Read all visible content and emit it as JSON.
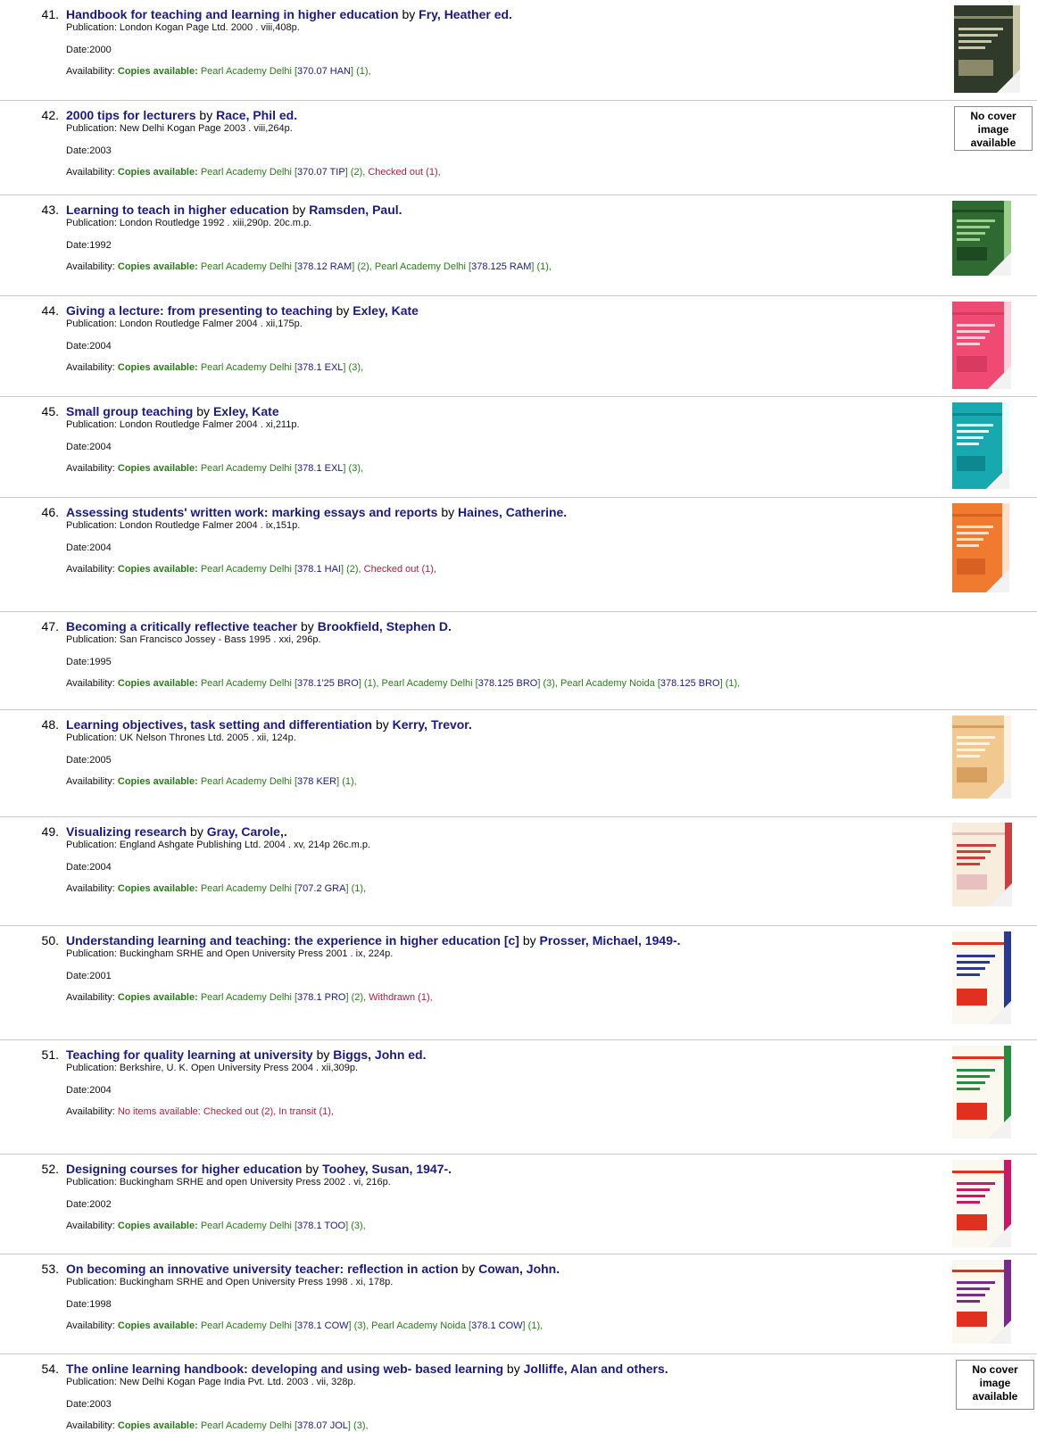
{
  "records": [
    {
      "num": "41.",
      "title": "Handbook for teaching and learning in higher education",
      "by": "by",
      "author": "Fry, Heather ed.",
      "publication": "Publication: London Kogan Page Ltd. 2000 . viii,408p.",
      "date": "Date:2000",
      "availability_label": "Availability:",
      "availability": [
        {
          "kind": "ca",
          "text": "Copies available:"
        },
        {
          "kind": "lib",
          "text": " Pearl Academy Delhi ["
        },
        {
          "kind": "call",
          "text": "370.07 HAN"
        },
        {
          "kind": "lib",
          "text": "] (1),"
        }
      ],
      "cover": {
        "type": "image",
        "bg": "#2f3a2a",
        "accent": "#c8c8a8",
        "band": "#8a8a6a",
        "text": "TEACHING & LEARNING IN HIGHER EDUCATION"
      }
    },
    {
      "num": "42.",
      "title": "2000 tips for lecturers",
      "by": "by",
      "author": "Race, Phil ed.",
      "publication": "Publication: New Delhi Kogan Page 2003 . viii,264p.",
      "date": "Date:2003",
      "availability_label": "Availability:",
      "availability": [
        {
          "kind": "ca",
          "text": "Copies available:"
        },
        {
          "kind": "lib",
          "text": " Pearl Academy Delhi ["
        },
        {
          "kind": "call",
          "text": "370.07 TIP"
        },
        {
          "kind": "lib",
          "text": "] (2),"
        },
        {
          "kind": "co",
          "text": " Checked out (1),"
        }
      ],
      "cover": {
        "type": "none",
        "text": "No cover image available"
      }
    },
    {
      "num": "43.",
      "title": "Learning to teach in higher education",
      "by": "by",
      "author": "Ramsden, Paul.",
      "publication": "Publication: London Routledge 1992 . xiii,290p. 20c.m.p.",
      "date": "Date:1992",
      "availability_label": "Availability:",
      "availability": [
        {
          "kind": "ca",
          "text": "Copies available:"
        },
        {
          "kind": "lib",
          "text": " Pearl Academy Delhi ["
        },
        {
          "kind": "call",
          "text": "378.12 RAM"
        },
        {
          "kind": "lib",
          "text": "] (2), Pearl Academy Delhi ["
        },
        {
          "kind": "call",
          "text": "378.125 RAM"
        },
        {
          "kind": "lib",
          "text": "] (1),"
        }
      ],
      "cover": {
        "type": "image",
        "bg": "#2e6a32",
        "accent": "#9ad08a",
        "band": "#1e4a22",
        "text": "Learning TO TEACH IN HIGHER EDUCATION"
      }
    },
    {
      "num": "44.",
      "title": "Giving a lecture: from presenting to teaching",
      "by": "by",
      "author": "Exley, Kate",
      "publication": "Publication: London Routledge Falmer 2004 . xii,175p.",
      "date": "Date:2004",
      "availability_label": "Availability:",
      "availability": [
        {
          "kind": "ca",
          "text": "Copies available:"
        },
        {
          "kind": "lib",
          "text": " Pearl Academy Delhi ["
        },
        {
          "kind": "call",
          "text": "378.1 EXL"
        },
        {
          "kind": "lib",
          "text": "] (3),"
        }
      ],
      "cover": {
        "type": "image",
        "bg": "#f04a72",
        "accent": "#ffd0dc",
        "band": "#d83a60",
        "text": "GIVING A LECTURE"
      }
    },
    {
      "num": "45.",
      "title": "Small group teaching",
      "by": "by",
      "author": "Exley, Kate",
      "publication": "Publication: London Routledge Falmer 2004 . xi,211p.",
      "date": "Date:2004",
      "availability_label": "Availability:",
      "availability": [
        {
          "kind": "ca",
          "text": "Copies available:"
        },
        {
          "kind": "lib",
          "text": " Pearl Academy Delhi ["
        },
        {
          "kind": "call",
          "text": "378.1 EXL"
        },
        {
          "kind": "lib",
          "text": "] (3),"
        }
      ],
      "cover": {
        "type": "image",
        "bg": "#18a8b0",
        "accent": "#e8ffff",
        "band": "#0e8890",
        "text": "SMALL GROUP TEACHING"
      }
    },
    {
      "num": "46.",
      "title": "Assessing students' written work: marking essays and reports",
      "by": "by",
      "author": "Haines, Catherine.",
      "publication": "Publication: London Routledge Falmer 2004 . ix,151p.",
      "date": "Date:2004",
      "availability_label": "Availability:",
      "availability": [
        {
          "kind": "ca",
          "text": "Copies available:"
        },
        {
          "kind": "lib",
          "text": " Pearl Academy Delhi ["
        },
        {
          "kind": "call",
          "text": "378.1 HAI"
        },
        {
          "kind": "lib",
          "text": "] (2),"
        },
        {
          "kind": "co",
          "text": " Checked out (1),"
        }
      ],
      "cover": {
        "type": "image",
        "bg": "#f07a30",
        "accent": "#ffe0c8",
        "band": "#d86020",
        "text": "ASSESSING STUDENTS' WRITTEN WORK"
      }
    },
    {
      "num": "47.",
      "title": "Becoming a critically reflective teacher",
      "by": "by",
      "author": "Brookfield, Stephen D.",
      "publication": "Publication: San Francisco Jossey - Bass 1995 . xxi, 296p.",
      "date": "Date:1995",
      "availability_label": "Availability:",
      "availability": [
        {
          "kind": "ca",
          "text": "Copies available:"
        },
        {
          "kind": "lib",
          "text": " Pearl Academy Delhi ["
        },
        {
          "kind": "call",
          "text": "378.1'25 BRO"
        },
        {
          "kind": "lib",
          "text": "] (1), Pearl Academy Delhi ["
        },
        {
          "kind": "call",
          "text": "378.125 BRO"
        },
        {
          "kind": "lib",
          "text": "] (3), Pearl Academy Noida ["
        },
        {
          "kind": "call",
          "text": "378.125 BRO"
        },
        {
          "kind": "lib",
          "text": "] (1),"
        }
      ],
      "cover": {
        "type": "blank"
      }
    },
    {
      "num": "48.",
      "title": "Learning objectives, task setting and differentiation",
      "by": "by",
      "author": "Kerry, Trevor.",
      "publication": "Publication: UK Nelson Thrones Ltd. 2005 . xii, 124p.",
      "date": "Date:2005",
      "availability_label": "Availability:",
      "availability": [
        {
          "kind": "ca",
          "text": "Copies available:"
        },
        {
          "kind": "lib",
          "text": " Pearl Academy Delhi ["
        },
        {
          "kind": "call",
          "text": "378 KER"
        },
        {
          "kind": "lib",
          "text": "] (1),"
        }
      ],
      "cover": {
        "type": "image",
        "bg": "#f0c890",
        "accent": "#fff2e0",
        "band": "#d8a060",
        "text": "Learning Objectives, Task Setting and Differentiation"
      }
    },
    {
      "num": "49.",
      "title": "Visualizing research",
      "by": "by",
      "author": "Gray, Carole,.",
      "publication": "Publication: England Ashgate Publishing Ltd. 2004 . xv, 214p 26c.m.p.",
      "date": "Date:2004",
      "availability_label": "Availability:",
      "availability": [
        {
          "kind": "ca",
          "text": "Copies available:"
        },
        {
          "kind": "lib",
          "text": " Pearl Academy Delhi ["
        },
        {
          "kind": "call",
          "text": "707.2 GRA"
        },
        {
          "kind": "lib",
          "text": "] (1),"
        }
      ],
      "cover": {
        "type": "image",
        "bg": "#f8ecdc",
        "accent": "#c84040",
        "band": "#e8c0c0",
        "text": "VISUALIZING RESEARCH"
      }
    },
    {
      "num": "50.",
      "title": "Understanding learning and teaching: the experience in higher education [c]",
      "by": "by",
      "author": "Prosser, Michael, 1949-.",
      "publication": "Publication: Buckingham SRHE and Open University Press 2001 . ix, 224p.",
      "date": "Date:2001",
      "availability_label": "Availability:",
      "availability": [
        {
          "kind": "ca",
          "text": "Copies available:"
        },
        {
          "kind": "lib",
          "text": " Pearl Academy Delhi ["
        },
        {
          "kind": "call",
          "text": "378.1 PRO"
        },
        {
          "kind": "lib",
          "text": "] (2),"
        },
        {
          "kind": "co",
          "text": " Withdrawn (1),"
        }
      ],
      "cover": {
        "type": "image",
        "bg": "#fbf8f0",
        "accent": "#2a3a90",
        "band": "#e03020",
        "text": "Understanding Learning and Teaching"
      }
    },
    {
      "num": "51.",
      "title": "Teaching for quality learning at university",
      "by": "by",
      "author": "Biggs, John ed.",
      "publication": "Publication: Berkshire, U. K. Open University Press 2004 . xii,309p.",
      "date": "Date:2004",
      "availability_label": "Availability:",
      "availability": [
        {
          "kind": "co",
          "text": "No items available: Checked out (2), In transit (1),"
        }
      ],
      "cover": {
        "type": "image",
        "bg": "#fbf8f0",
        "accent": "#2a8a40",
        "band": "#e03020",
        "text": "Teaching for Quality Learning at University"
      }
    },
    {
      "num": "52.",
      "title": "Designing courses for higher education",
      "by": "by",
      "author": "Toohey, Susan, 1947-.",
      "publication": "Publication: Buckingham SRHE and open University Press 2002 . vi, 216p.",
      "date": "Date:2002",
      "availability_label": "Availability:",
      "availability": [
        {
          "kind": "ca",
          "text": "Copies available:"
        },
        {
          "kind": "lib",
          "text": " Pearl Academy Delhi ["
        },
        {
          "kind": "call",
          "text": "378.1 TOO"
        },
        {
          "kind": "lib",
          "text": "] (3),"
        }
      ],
      "cover": {
        "type": "image",
        "bg": "#fbf8f0",
        "accent": "#c81868",
        "band": "#e03020",
        "text": "Designing Courses for Higher Education"
      }
    },
    {
      "num": "53.",
      "title": "On becoming an innovative university teacher: reflection in action",
      "by": "by",
      "author": "Cowan, John.",
      "publication": "Publication: Buckingham SRHE and Open University Press 1998 . xi, 178p.",
      "date": "Date:1998",
      "availability_label": "Availability:",
      "availability": [
        {
          "kind": "ca",
          "text": "Copies available:"
        },
        {
          "kind": "lib",
          "text": " Pearl Academy Delhi ["
        },
        {
          "kind": "call",
          "text": "378.1 COW"
        },
        {
          "kind": "lib",
          "text": "] (3), Pearl Academy Noida ["
        },
        {
          "kind": "call",
          "text": "378.1 COW"
        },
        {
          "kind": "lib",
          "text": "] (1),"
        }
      ],
      "cover": {
        "type": "image",
        "bg": "#fbf8f0",
        "accent": "#7a2a8a",
        "band": "#e03020",
        "text": "On Becoming an Innovative University Teacher"
      }
    },
    {
      "num": "54.",
      "title": "The online learning handbook: developing and using web- based learning",
      "by": "by",
      "author": "Jolliffe, Alan and others.",
      "publication": "Publication: New Delhi Kogan Page India Pvt. Ltd. 2003 . vii, 328p.",
      "date": "Date:2003",
      "availability_label": "Availability:",
      "availability": [
        {
          "kind": "ca",
          "text": "Copies available:"
        },
        {
          "kind": "lib",
          "text": " Pearl Academy Delhi ["
        },
        {
          "kind": "call",
          "text": "378.07 JOL"
        },
        {
          "kind": "lib",
          "text": "] (3),"
        }
      ],
      "cover": {
        "type": "none",
        "text": "No cover image available"
      }
    }
  ]
}
